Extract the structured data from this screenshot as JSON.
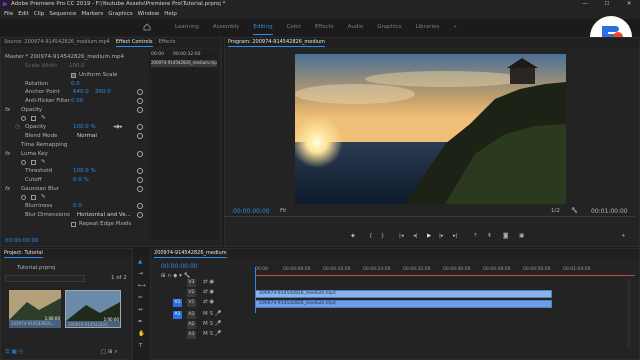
{
  "window": {
    "title": "Adobe Premiere Pro CC 2019 - F:\\Youtube Assets\\Premiere Pro\\Tutorial.prproj *",
    "minimize": "—",
    "maximize": "☐",
    "close": "✕"
  },
  "menu": [
    "File",
    "Edit",
    "Clip",
    "Sequence",
    "Markers",
    "Graphics",
    "Window",
    "Help"
  ],
  "workspaces": [
    "Learning",
    "Assembly",
    "Editing",
    "Color",
    "Effects",
    "Audio",
    "Graphics",
    "Libraries"
  ],
  "workspaces_overflow": "»",
  "effects_panel": {
    "tabs": [
      "Source: 200974-914542826_medium.mp4",
      "Effect Controls",
      "Effects"
    ],
    "master": "Master * 200974-914542826_medium.mp4",
    "clip": "200974-914542826_medium.mp4",
    "timecode_start": "00:00",
    "timecode_mid": "00:00:32:00",
    "rows": {
      "scale_width": "Scale Width",
      "scale_width_val": "100.0",
      "uniform_scale": "Uniform Scale",
      "rotation": "Rotation",
      "rotation_val": "0.0",
      "anchor_point": "Anchor Point",
      "anchor_x": "640.0",
      "anchor_y": "360.0",
      "anti_flicker": "Anti-flicker Filter",
      "anti_flicker_val": "0.00",
      "opacity_fx": "Opacity",
      "opacity": "Opacity",
      "opacity_val": "100.0 %",
      "blend_mode": "Blend Mode",
      "blend_mode_val": "Normal",
      "time_remap": "Time Remapping",
      "luma_key": "Luma Key",
      "threshold": "Threshold",
      "threshold_val": "100.0 %",
      "cutoff": "Cutoff",
      "cutoff_val": "0.0 %",
      "gaussian_blur": "Gaussian Blur",
      "blurriness": "Blurriness",
      "blurriness_val": "0.0",
      "blur_dim": "Blur Dimensions",
      "blur_dim_val": "Horizontal and Ve...",
      "repeat_edge": "Repeat Edge Pixels"
    },
    "footer_time": "00:00:00:00"
  },
  "program": {
    "title": "Program: 200974-914542826_medium",
    "timecode": "00:00:00:00",
    "fit": "Fit",
    "resolution": "1/2",
    "duration": "00:01:00:00"
  },
  "project": {
    "title": "Project: Tutorial",
    "file": "Tutorial.prproj",
    "count": "1 of 2",
    "items": [
      {
        "name": "200974-914542826...",
        "dur": "1:00:00"
      },
      {
        "name": "200974-914542826...",
        "dur": "1:00:00"
      }
    ]
  },
  "timeline": {
    "tab": "200974-914542826_medium",
    "timecode": "00:00:00:00",
    "ticks": [
      "00:00",
      "00:00:08:00",
      "00:00:16:00",
      "00:00:24:00",
      "00:00:32:00",
      "00:00:40:00",
      "00:00:48:00",
      "00:00:56:00",
      "00:01:04:00"
    ],
    "video_tracks": [
      "V3",
      "V2",
      "V1"
    ],
    "audio_tracks": [
      "A1",
      "A2",
      "A3"
    ],
    "clip_v2": "200974-914542826_medium.mp4",
    "clip_v1": "200974-914542826_medium.mp4"
  },
  "colors": {
    "accent": "#2d8ceb",
    "clip": "#8ab3e8",
    "bg": "#232323"
  }
}
